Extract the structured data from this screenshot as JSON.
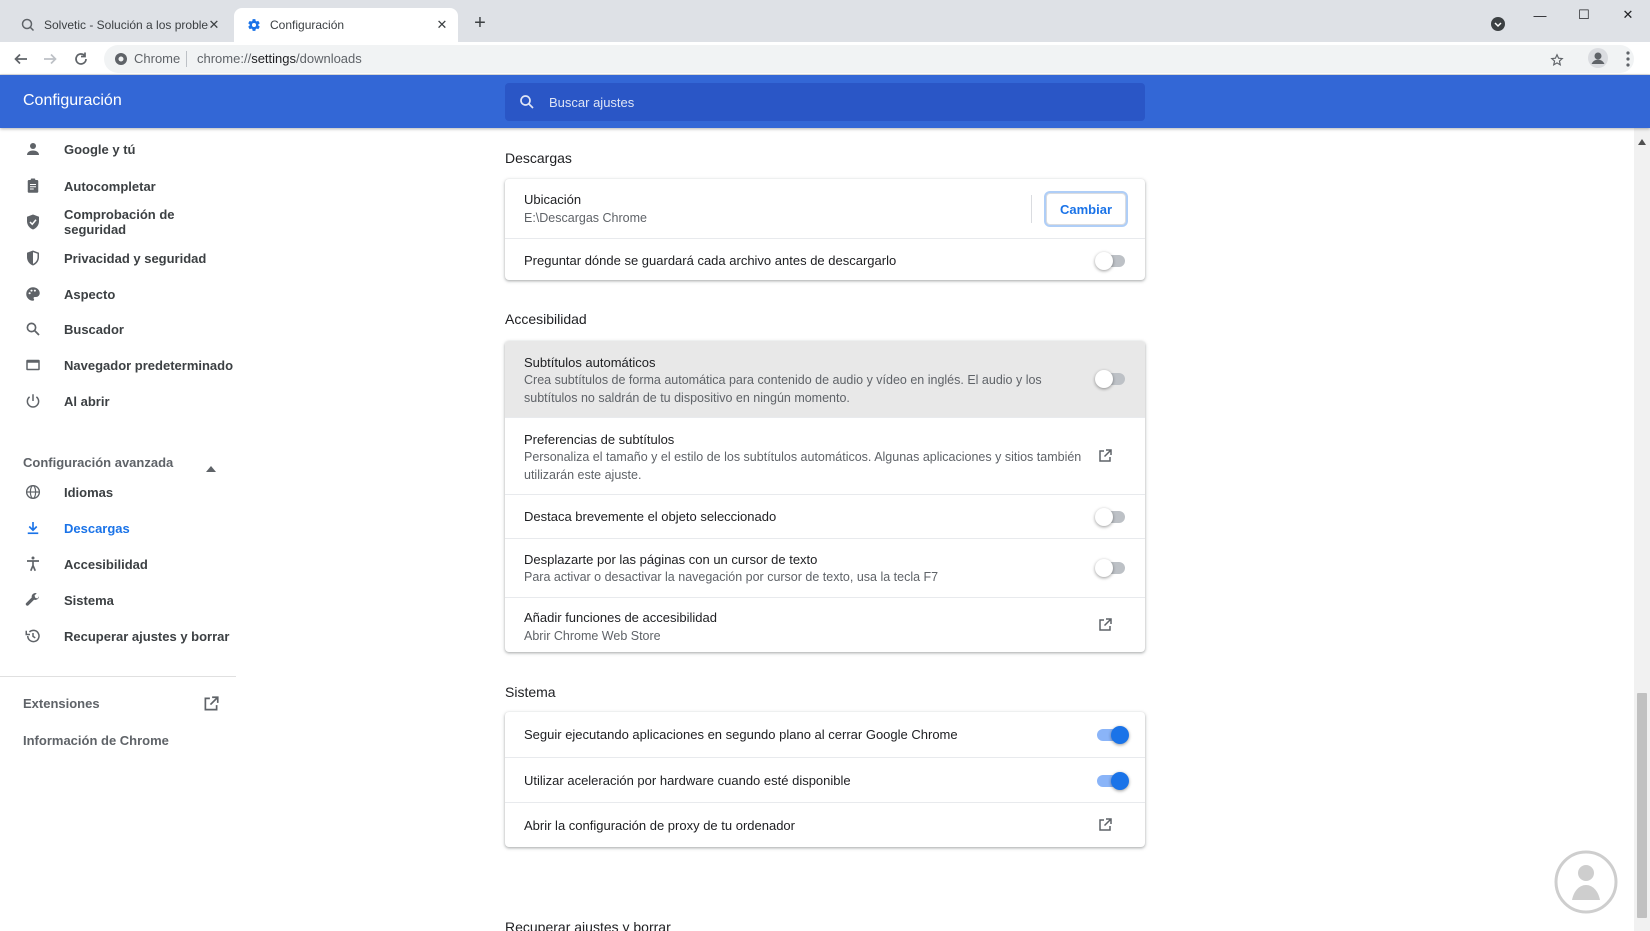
{
  "tabs": [
    {
      "title": "Solvetic - Solución a los problem",
      "active": false
    },
    {
      "title": "Configuración",
      "active": true
    }
  ],
  "toolbar": {
    "chip": "Chrome",
    "url_prefix": "chrome://",
    "url_host": "settings",
    "url_path": "/downloads"
  },
  "header": {
    "title": "Configuración",
    "search_placeholder": "Buscar ajustes"
  },
  "sidebar": {
    "items": [
      {
        "label": "Google y tú",
        "icon": "person-icon"
      },
      {
        "label": "Autocompletar",
        "icon": "clipboard-icon"
      },
      {
        "label": "Comprobación de seguridad",
        "icon": "shield-check-icon"
      },
      {
        "label": "Privacidad y seguridad",
        "icon": "shield-icon"
      },
      {
        "label": "Aspecto",
        "icon": "palette-icon"
      },
      {
        "label": "Buscador",
        "icon": "search-icon"
      },
      {
        "label": "Navegador predeterminado",
        "icon": "browser-icon"
      },
      {
        "label": "Al abrir",
        "icon": "power-icon"
      }
    ],
    "advanced_label": "Configuración avanzada",
    "advanced_items": [
      {
        "label": "Idiomas",
        "icon": "globe-icon"
      },
      {
        "label": "Descargas",
        "icon": "download-icon",
        "selected": true
      },
      {
        "label": "Accesibilidad",
        "icon": "accessibility-icon"
      },
      {
        "label": "Sistema",
        "icon": "wrench-icon"
      },
      {
        "label": "Recuperar ajustes y borrar",
        "icon": "history-icon"
      }
    ],
    "extensions_label": "Extensiones",
    "about_label": "Información de Chrome"
  },
  "downloads": {
    "section_title": "Descargas",
    "location_title": "Ubicación",
    "location_value": "E:\\Descargas Chrome",
    "change_button": "Cambiar",
    "ask_label": "Preguntar dónde se guardará cada archivo antes de descargarlo",
    "ask_enabled": false
  },
  "accessibility": {
    "section_title": "Accesibilidad",
    "live_caption_title": "Subtítulos automáticos",
    "live_caption_sub1": "Crea subtítulos de forma automática para contenido de audio y vídeo en inglés. El audio y los",
    "live_caption_sub2": "subtítulos no saldrán de tu dispositivo en ningún momento.",
    "live_caption_enabled": false,
    "caption_prefs_title": "Preferencias de subtítulos",
    "caption_prefs_sub1": "Personaliza el tamaño y el estilo de los subtítulos automáticos. Algunas aplicaciones y sitios también",
    "caption_prefs_sub2": "utilizarán este ajuste.",
    "focus_highlight_title": "Destaca brevemente el objeto seleccionado",
    "focus_highlight_enabled": false,
    "caret_title": "Desplazarte por las páginas con un cursor de texto",
    "caret_sub": "Para activar o desactivar la navegación por cursor de texto, usa la tecla F7",
    "caret_enabled": false,
    "add_features_title": "Añadir funciones de accesibilidad",
    "add_features_sub": "Abrir Chrome Web Store"
  },
  "system": {
    "section_title": "Sistema",
    "background_apps_title": "Seguir ejecutando aplicaciones en segundo plano al cerrar Google Chrome",
    "background_apps_enabled": true,
    "hw_accel_title": "Utilizar aceleración por hardware cuando esté disponible",
    "hw_accel_enabled": true,
    "proxy_title": "Abrir la configuración de proxy de tu ordenador"
  },
  "reset": {
    "section_title": "Recuperar ajustes y borrar"
  },
  "colors": {
    "header_blue": "#3367d6",
    "accent": "#1a73e8"
  }
}
